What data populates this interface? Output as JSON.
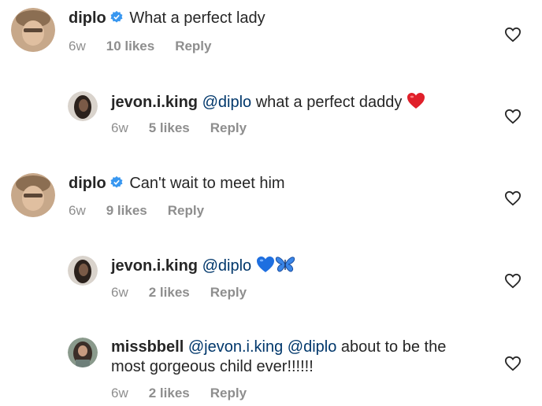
{
  "comments": [
    {
      "username": "diplo",
      "text": "What a perfect lady",
      "time": "6w",
      "likes": "10 likes",
      "reply": "Reply"
    },
    {
      "username": "jevon.i.king",
      "mention": "@diplo",
      "text": "what a perfect daddy",
      "emoji": "red-heart",
      "time": "6w",
      "likes": "5 likes",
      "reply": "Reply"
    },
    {
      "username": "diplo",
      "text": "Can't wait to meet him",
      "time": "6w",
      "likes": "9 likes",
      "reply": "Reply"
    },
    {
      "username": "jevon.i.king",
      "mention": "@diplo",
      "emoji": [
        "blue-heart",
        "butterfly"
      ],
      "time": "6w",
      "likes": "2 likes",
      "reply": "Reply"
    },
    {
      "username": "missbbell",
      "mention1": "@jevon.i.king",
      "mention2": "@diplo",
      "text_line1": "about to be the",
      "text_line2": "most gorgeous child ever!!!!!!",
      "time": "6w",
      "likes": "2 likes",
      "reply": "Reply"
    }
  ],
  "colors": {
    "text": "#262626",
    "meta": "#8e8e8e",
    "mention": "#00376b",
    "verified": "#3897f0"
  }
}
